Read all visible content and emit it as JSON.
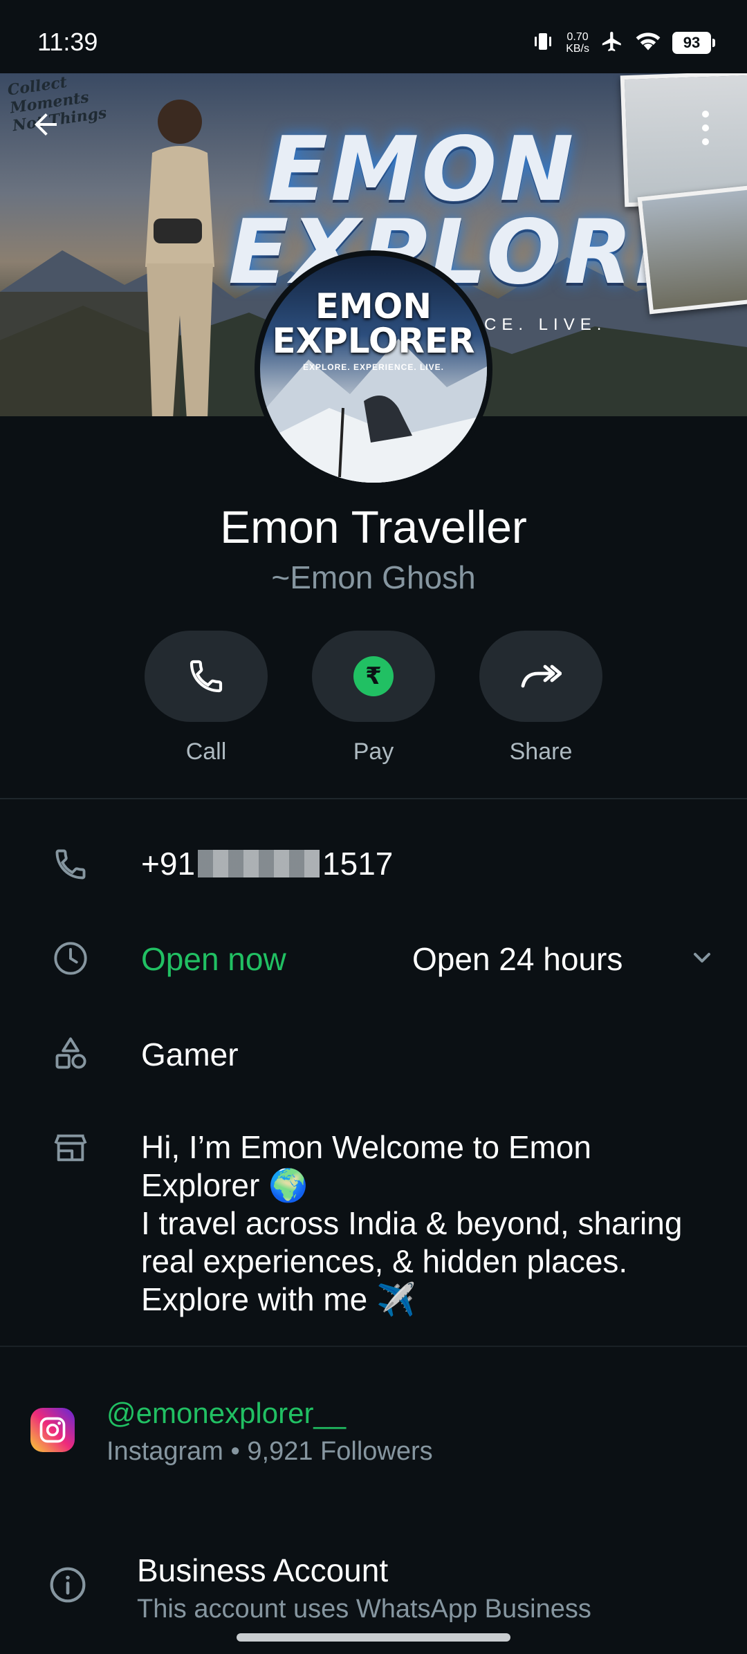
{
  "status_bar": {
    "time": "11:39",
    "net_speed_value": "0.70",
    "net_speed_unit": "KB/s",
    "battery": "93",
    "icons": [
      "vibrate-icon",
      "airplane-icon",
      "wifi-icon",
      "battery-icon"
    ]
  },
  "cover": {
    "title_line1": "EMON",
    "title_line2": "EXPLORER",
    "tagline": "CE. LIVE.",
    "script_text": "Collect\nMoments\nNot Things"
  },
  "avatar": {
    "title_line1": "EMON",
    "title_line2": "EXPLORER",
    "tagline": "EXPLORE. EXPERIENCE. LIVE."
  },
  "profile": {
    "name": "Emon Traveller",
    "pushname": "~Emon Ghosh"
  },
  "actions": {
    "call": "Call",
    "pay": "Pay",
    "pay_symbol": "₹",
    "share": "Share"
  },
  "info": {
    "phone_prefix": "+91",
    "phone_suffix": "1517",
    "open_status": "Open now",
    "hours": "Open 24 hours",
    "category": "Gamer",
    "about": "Hi, I’m Emon Welcome to Emon\nExplorer 🌍\nI travel across India & beyond, sharing\nreal experiences, & hidden places.\nExplore with me ✈️"
  },
  "instagram": {
    "handle": "@emonexplorer__",
    "meta": "Instagram • 9,921 Followers"
  },
  "business": {
    "title": "Business Account",
    "subtitle": "This account uses WhatsApp Business"
  },
  "colors": {
    "background": "#0b1014",
    "accent_green": "#21c063",
    "secondary_text": "#8696a0",
    "pill": "#232a30"
  }
}
